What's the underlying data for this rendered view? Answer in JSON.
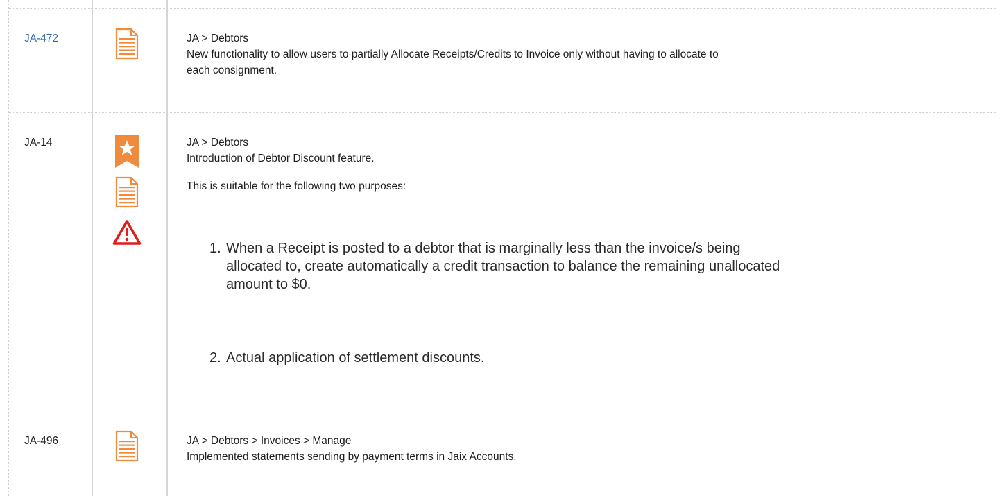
{
  "rows": [
    {
      "id": "JA-472",
      "id_is_link": true,
      "icons": [
        "document-icon"
      ],
      "path": "JA > Debtors",
      "lines": [
        "New functionality to allow users to partially Allocate Receipts/Credits to Invoice only without having to allocate to",
        "each consignment."
      ]
    },
    {
      "id": "JA-14",
      "id_is_link": false,
      "icons": [
        "star-bookmark-icon",
        "document-icon",
        "warning-icon"
      ],
      "path": "JA > Debtors",
      "lines": [
        "Introduction of Debtor Discount feature."
      ],
      "intro": "This is suitable for the following two purposes:",
      "list": [
        {
          "num": "1.",
          "lines": [
            "When a Receipt is posted to a debtor that is marginally less than the invoice/s being",
            "allocated to, create automatically a credit transaction to balance the remaining unallocated",
            "amount to $0."
          ]
        },
        {
          "num": "2.",
          "lines": [
            "Actual application of settlement discounts."
          ]
        }
      ]
    },
    {
      "id": "JA-496",
      "id_is_link": false,
      "icons": [
        "document-icon"
      ],
      "path": "JA > Debtors > Invoices > Manage",
      "lines": [
        "Implemented statements sending by payment terms in Jaix Accounts."
      ]
    }
  ],
  "colors": {
    "link": "#2f6fb0",
    "icon_orange": "#f08a3c",
    "warning_red": "#e31b1b",
    "border": "#d6d6d6"
  }
}
